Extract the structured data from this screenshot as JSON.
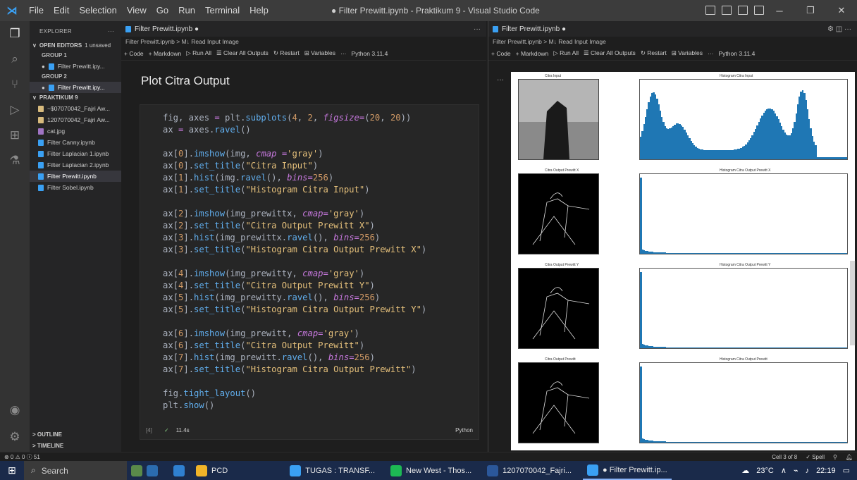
{
  "window": {
    "title": "● Filter Prewitt.ipynb - Praktikum 9 - Visual Studio Code",
    "menu": [
      "File",
      "Edit",
      "Selection",
      "View",
      "Go",
      "Run",
      "Terminal",
      "Help"
    ]
  },
  "sidebar": {
    "header": "EXPLORER",
    "header_more": "···",
    "open_editors": {
      "label": "OPEN EDITORS",
      "unsaved": "1 unsaved"
    },
    "groups": [
      {
        "label": "GROUP 1",
        "file": "Filter Prewitt.ipy..."
      },
      {
        "label": "GROUP 2",
        "file": "Filter Prewitt.ipy..."
      }
    ],
    "project": "PRAKTIKUM 9",
    "files": [
      "~$07070042_Fajri Aw...",
      "1207070042_Fajri Aw...",
      "cat.jpg",
      "Filter Canny.ipynb",
      "Filter Laplacian 1.ipynb",
      "Filter Laplacian 2.ipynb",
      "Filter Prewitt.ipynb",
      "Filter Sobel.ipynb"
    ],
    "outline": "OUTLINE",
    "timeline": "TIMELINE"
  },
  "left_editor": {
    "tab": "Filter Prewitt.ipynb ●",
    "breadcrumb": "Filter Prewitt.ipynb > M↓ Read Input Image",
    "toolbar": [
      "+ Code",
      "+ Markdown",
      "▷ Run All",
      "☰ Clear All Outputs",
      "↻ Restart",
      "⊞ Variables",
      "···",
      "Python 3.11.4"
    ],
    "heading": "Plot Citra Output",
    "exec_count": "[4]",
    "exec_time": "11.4s",
    "cell_lang": "Python"
  },
  "right_editor": {
    "tab": "Filter Prewitt.ipynb ●",
    "breadcrumb": "Filter Prewitt.ipynb > M↓ Read Input Image",
    "toolbar": [
      "+ Code",
      "+ Markdown",
      "▷ Run All",
      "☰ Clear All Outputs",
      "↻ Restart",
      "⊞ Variables",
      "···",
      "Python 3.11.4"
    ],
    "out_dots": "···",
    "plots": [
      {
        "title": "Citra Input",
        "hist_title": "Histogram Citra Input"
      },
      {
        "title": "Citra Output Prewitt X",
        "hist_title": "Histogram Citra Output Prewitt X"
      },
      {
        "title": "Citra Output Prewitt Y",
        "hist_title": "Histogram Citra Output Prewitt Y"
      },
      {
        "title": "Citra Output Prewitt",
        "hist_title": "Histogram Citra Output Prewitt"
      }
    ]
  },
  "code": {
    "lines": [
      [
        [
          "c-plain",
          "fig, axes "
        ],
        [
          "c-op",
          "="
        ],
        [
          "c-plain",
          " plt."
        ],
        [
          "c-met",
          "subplots"
        ],
        [
          "c-plain",
          "("
        ],
        [
          "c-num",
          "4"
        ],
        [
          "c-plain",
          ", "
        ],
        [
          "c-num",
          "2"
        ],
        [
          "c-plain",
          ", "
        ],
        [
          "c-kw",
          "figsize"
        ],
        [
          "c-op",
          "="
        ],
        [
          "c-plain",
          "("
        ],
        [
          "c-num",
          "20"
        ],
        [
          "c-plain",
          ", "
        ],
        [
          "c-num",
          "20"
        ],
        [
          "c-plain",
          "))"
        ]
      ],
      [
        [
          "c-plain",
          "ax "
        ],
        [
          "c-op",
          "="
        ],
        [
          "c-plain",
          " axes."
        ],
        [
          "c-met",
          "ravel"
        ],
        [
          "c-plain",
          "()"
        ]
      ],
      [],
      [
        [
          "c-plain",
          "ax["
        ],
        [
          "c-num",
          "0"
        ],
        [
          "c-plain",
          "]."
        ],
        [
          "c-met",
          "imshow"
        ],
        [
          "c-plain",
          "(img, "
        ],
        [
          "c-kw",
          "cmap"
        ],
        [
          "c-plain",
          " "
        ],
        [
          "c-op",
          "="
        ],
        [
          "c-str",
          "'gray'"
        ],
        [
          "c-plain",
          ")"
        ]
      ],
      [
        [
          "c-plain",
          "ax["
        ],
        [
          "c-num",
          "0"
        ],
        [
          "c-plain",
          "]."
        ],
        [
          "c-met",
          "set_title"
        ],
        [
          "c-plain",
          "("
        ],
        [
          "c-str",
          "\"Citra Input\""
        ],
        [
          "c-plain",
          ")"
        ]
      ],
      [
        [
          "c-plain",
          "ax["
        ],
        [
          "c-num",
          "1"
        ],
        [
          "c-plain",
          "]."
        ],
        [
          "c-met",
          "hist"
        ],
        [
          "c-plain",
          "(img."
        ],
        [
          "c-met",
          "ravel"
        ],
        [
          "c-plain",
          "(), "
        ],
        [
          "c-kw",
          "bins"
        ],
        [
          "c-op",
          "="
        ],
        [
          "c-num",
          "256"
        ],
        [
          "c-plain",
          ")"
        ]
      ],
      [
        [
          "c-plain",
          "ax["
        ],
        [
          "c-num",
          "1"
        ],
        [
          "c-plain",
          "]."
        ],
        [
          "c-met",
          "set_title"
        ],
        [
          "c-plain",
          "("
        ],
        [
          "c-str",
          "\"Histogram Citra Input\""
        ],
        [
          "c-plain",
          ")"
        ]
      ],
      [],
      [
        [
          "c-plain",
          "ax["
        ],
        [
          "c-num",
          "2"
        ],
        [
          "c-plain",
          "]."
        ],
        [
          "c-met",
          "imshow"
        ],
        [
          "c-plain",
          "(img_prewittx, "
        ],
        [
          "c-kw",
          "cmap"
        ],
        [
          "c-op",
          "="
        ],
        [
          "c-str",
          "'gray'"
        ],
        [
          "c-plain",
          ")"
        ]
      ],
      [
        [
          "c-plain",
          "ax["
        ],
        [
          "c-num",
          "2"
        ],
        [
          "c-plain",
          "]."
        ],
        [
          "c-met",
          "set_title"
        ],
        [
          "c-plain",
          "("
        ],
        [
          "c-str",
          "\"Citra Output Prewitt X\""
        ],
        [
          "c-plain",
          ")"
        ]
      ],
      [
        [
          "c-plain",
          "ax["
        ],
        [
          "c-num",
          "3"
        ],
        [
          "c-plain",
          "]."
        ],
        [
          "c-met",
          "hist"
        ],
        [
          "c-plain",
          "(img_prewittx."
        ],
        [
          "c-met",
          "ravel"
        ],
        [
          "c-plain",
          "(), "
        ],
        [
          "c-kw",
          "bins"
        ],
        [
          "c-op",
          "="
        ],
        [
          "c-num",
          "256"
        ],
        [
          "c-plain",
          ")"
        ]
      ],
      [
        [
          "c-plain",
          "ax["
        ],
        [
          "c-num",
          "3"
        ],
        [
          "c-plain",
          "]."
        ],
        [
          "c-met",
          "set_title"
        ],
        [
          "c-plain",
          "("
        ],
        [
          "c-str",
          "\"Histogram Citra Output Prewitt X\""
        ],
        [
          "c-plain",
          ")"
        ]
      ],
      [],
      [
        [
          "c-plain",
          "ax["
        ],
        [
          "c-num",
          "4"
        ],
        [
          "c-plain",
          "]."
        ],
        [
          "c-met",
          "imshow"
        ],
        [
          "c-plain",
          "(img_prewitty, "
        ],
        [
          "c-kw",
          "cmap"
        ],
        [
          "c-op",
          "="
        ],
        [
          "c-str",
          "'gray'"
        ],
        [
          "c-plain",
          ")"
        ]
      ],
      [
        [
          "c-plain",
          "ax["
        ],
        [
          "c-num",
          "4"
        ],
        [
          "c-plain",
          "]."
        ],
        [
          "c-met",
          "set_title"
        ],
        [
          "c-plain",
          "("
        ],
        [
          "c-str",
          "\"Citra Output Prewitt Y\""
        ],
        [
          "c-plain",
          ")"
        ]
      ],
      [
        [
          "c-plain",
          "ax["
        ],
        [
          "c-num",
          "5"
        ],
        [
          "c-plain",
          "]."
        ],
        [
          "c-met",
          "hist"
        ],
        [
          "c-plain",
          "(img_prewitty."
        ],
        [
          "c-met",
          "ravel"
        ],
        [
          "c-plain",
          "(), "
        ],
        [
          "c-kw",
          "bins"
        ],
        [
          "c-op",
          "="
        ],
        [
          "c-num",
          "256"
        ],
        [
          "c-plain",
          ")"
        ]
      ],
      [
        [
          "c-plain",
          "ax["
        ],
        [
          "c-num",
          "5"
        ],
        [
          "c-plain",
          "]."
        ],
        [
          "c-met",
          "set_title"
        ],
        [
          "c-plain",
          "("
        ],
        [
          "c-str",
          "\"Histogram Citra Output Prewitt Y\""
        ],
        [
          "c-plain",
          ")"
        ]
      ],
      [],
      [
        [
          "c-plain",
          "ax["
        ],
        [
          "c-num",
          "6"
        ],
        [
          "c-plain",
          "]."
        ],
        [
          "c-met",
          "imshow"
        ],
        [
          "c-plain",
          "(img_prewitt, "
        ],
        [
          "c-kw",
          "cmap"
        ],
        [
          "c-op",
          "="
        ],
        [
          "c-str",
          "'gray'"
        ],
        [
          "c-plain",
          ")"
        ]
      ],
      [
        [
          "c-plain",
          "ax["
        ],
        [
          "c-num",
          "6"
        ],
        [
          "c-plain",
          "]."
        ],
        [
          "c-met",
          "set_title"
        ],
        [
          "c-plain",
          "("
        ],
        [
          "c-str",
          "\"Citra Output Prewitt\""
        ],
        [
          "c-plain",
          ")"
        ]
      ],
      [
        [
          "c-plain",
          "ax["
        ],
        [
          "c-num",
          "7"
        ],
        [
          "c-plain",
          "]."
        ],
        [
          "c-met",
          "hist"
        ],
        [
          "c-plain",
          "(img_prewitt."
        ],
        [
          "c-met",
          "ravel"
        ],
        [
          "c-plain",
          "(), "
        ],
        [
          "c-kw",
          "bins"
        ],
        [
          "c-op",
          "="
        ],
        [
          "c-num",
          "256"
        ],
        [
          "c-plain",
          ")"
        ]
      ],
      [
        [
          "c-plain",
          "ax["
        ],
        [
          "c-num",
          "7"
        ],
        [
          "c-plain",
          "]."
        ],
        [
          "c-met",
          "set_title"
        ],
        [
          "c-plain",
          "("
        ],
        [
          "c-str",
          "\"Histogram Citra Output Prewitt\""
        ],
        [
          "c-plain",
          ")"
        ]
      ],
      [],
      [
        [
          "c-plain",
          "fig."
        ],
        [
          "c-met",
          "tight_layout"
        ],
        [
          "c-plain",
          "()"
        ]
      ],
      [
        [
          "c-plain",
          "plt."
        ],
        [
          "c-met",
          "show"
        ],
        [
          "c-plain",
          "()"
        ]
      ]
    ]
  },
  "statusbar": {
    "left": "⊗ 0 ⚠ 0 ⓘ 51",
    "cell": "Cell 3 of 8",
    "spell": "✓ Spell"
  },
  "taskbar": {
    "search": "Search",
    "apps": [
      "PCD",
      "TUGAS : TRANSF...",
      "New West - Thos...",
      "1207070042_Fajri...",
      "● Filter Prewitt.ip..."
    ],
    "temp": "23°C",
    "time": "22:19"
  },
  "colors": {
    "accent": "#007acc",
    "hist_bar": "#1f77b4"
  }
}
